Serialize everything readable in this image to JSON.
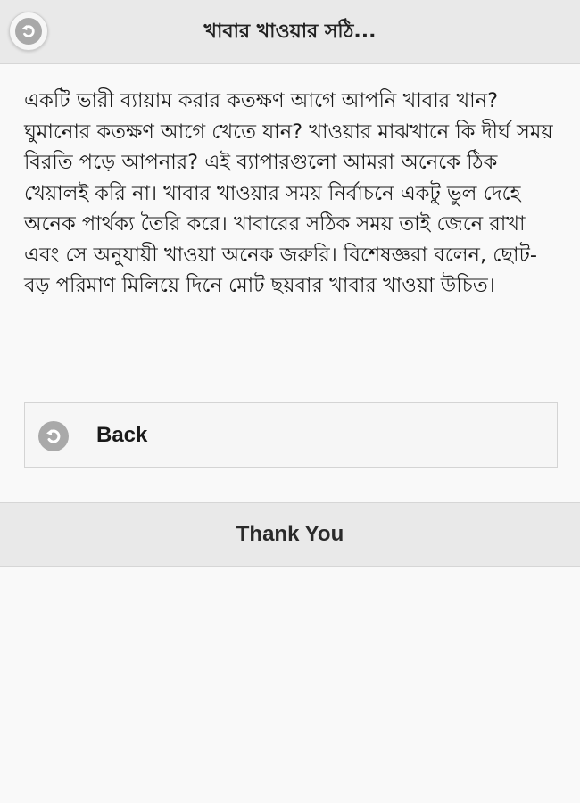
{
  "header": {
    "title": "খাবার খাওয়ার সঠি...",
    "back_icon": "undo-arrow-icon"
  },
  "content": {
    "paragraph": "একটি ভারী ব্যায়াম করার কতক্ষণ আগে আপনি খাবার খান? ঘুমানোর কতক্ষণ আগে খেতে যান? খাওয়ার মাঝখানে কি দীর্ঘ সময় বিরতি পড়ে আপনার? এই ব্যাপারগুলো আমরা অনেকে ঠিক খেয়ালই করি না। খাবার খাওয়ার সময় নির্বাচনে একটু ভুল দেহে অনেক পার্থক্য তৈরি করে। খাবারের সঠিক সময় তাই জেনে রাখা এবং সে অনুযায়ী খাওয়া অনেক জরুরি। বিশেষজ্ঞরা বলেন, ছোট-বড় পরিমাণ মিলিয়ে দিনে মোট ছয়বার খাবার খাওয়া উচিত।"
  },
  "back_button": {
    "label": "Back",
    "icon": "undo-arrow-icon"
  },
  "footer": {
    "label": "Thank You"
  },
  "colors": {
    "header_bg": "#e9e9e9",
    "icon_gray": "#a9a9a9",
    "page_bg": "#f9f9f9"
  }
}
